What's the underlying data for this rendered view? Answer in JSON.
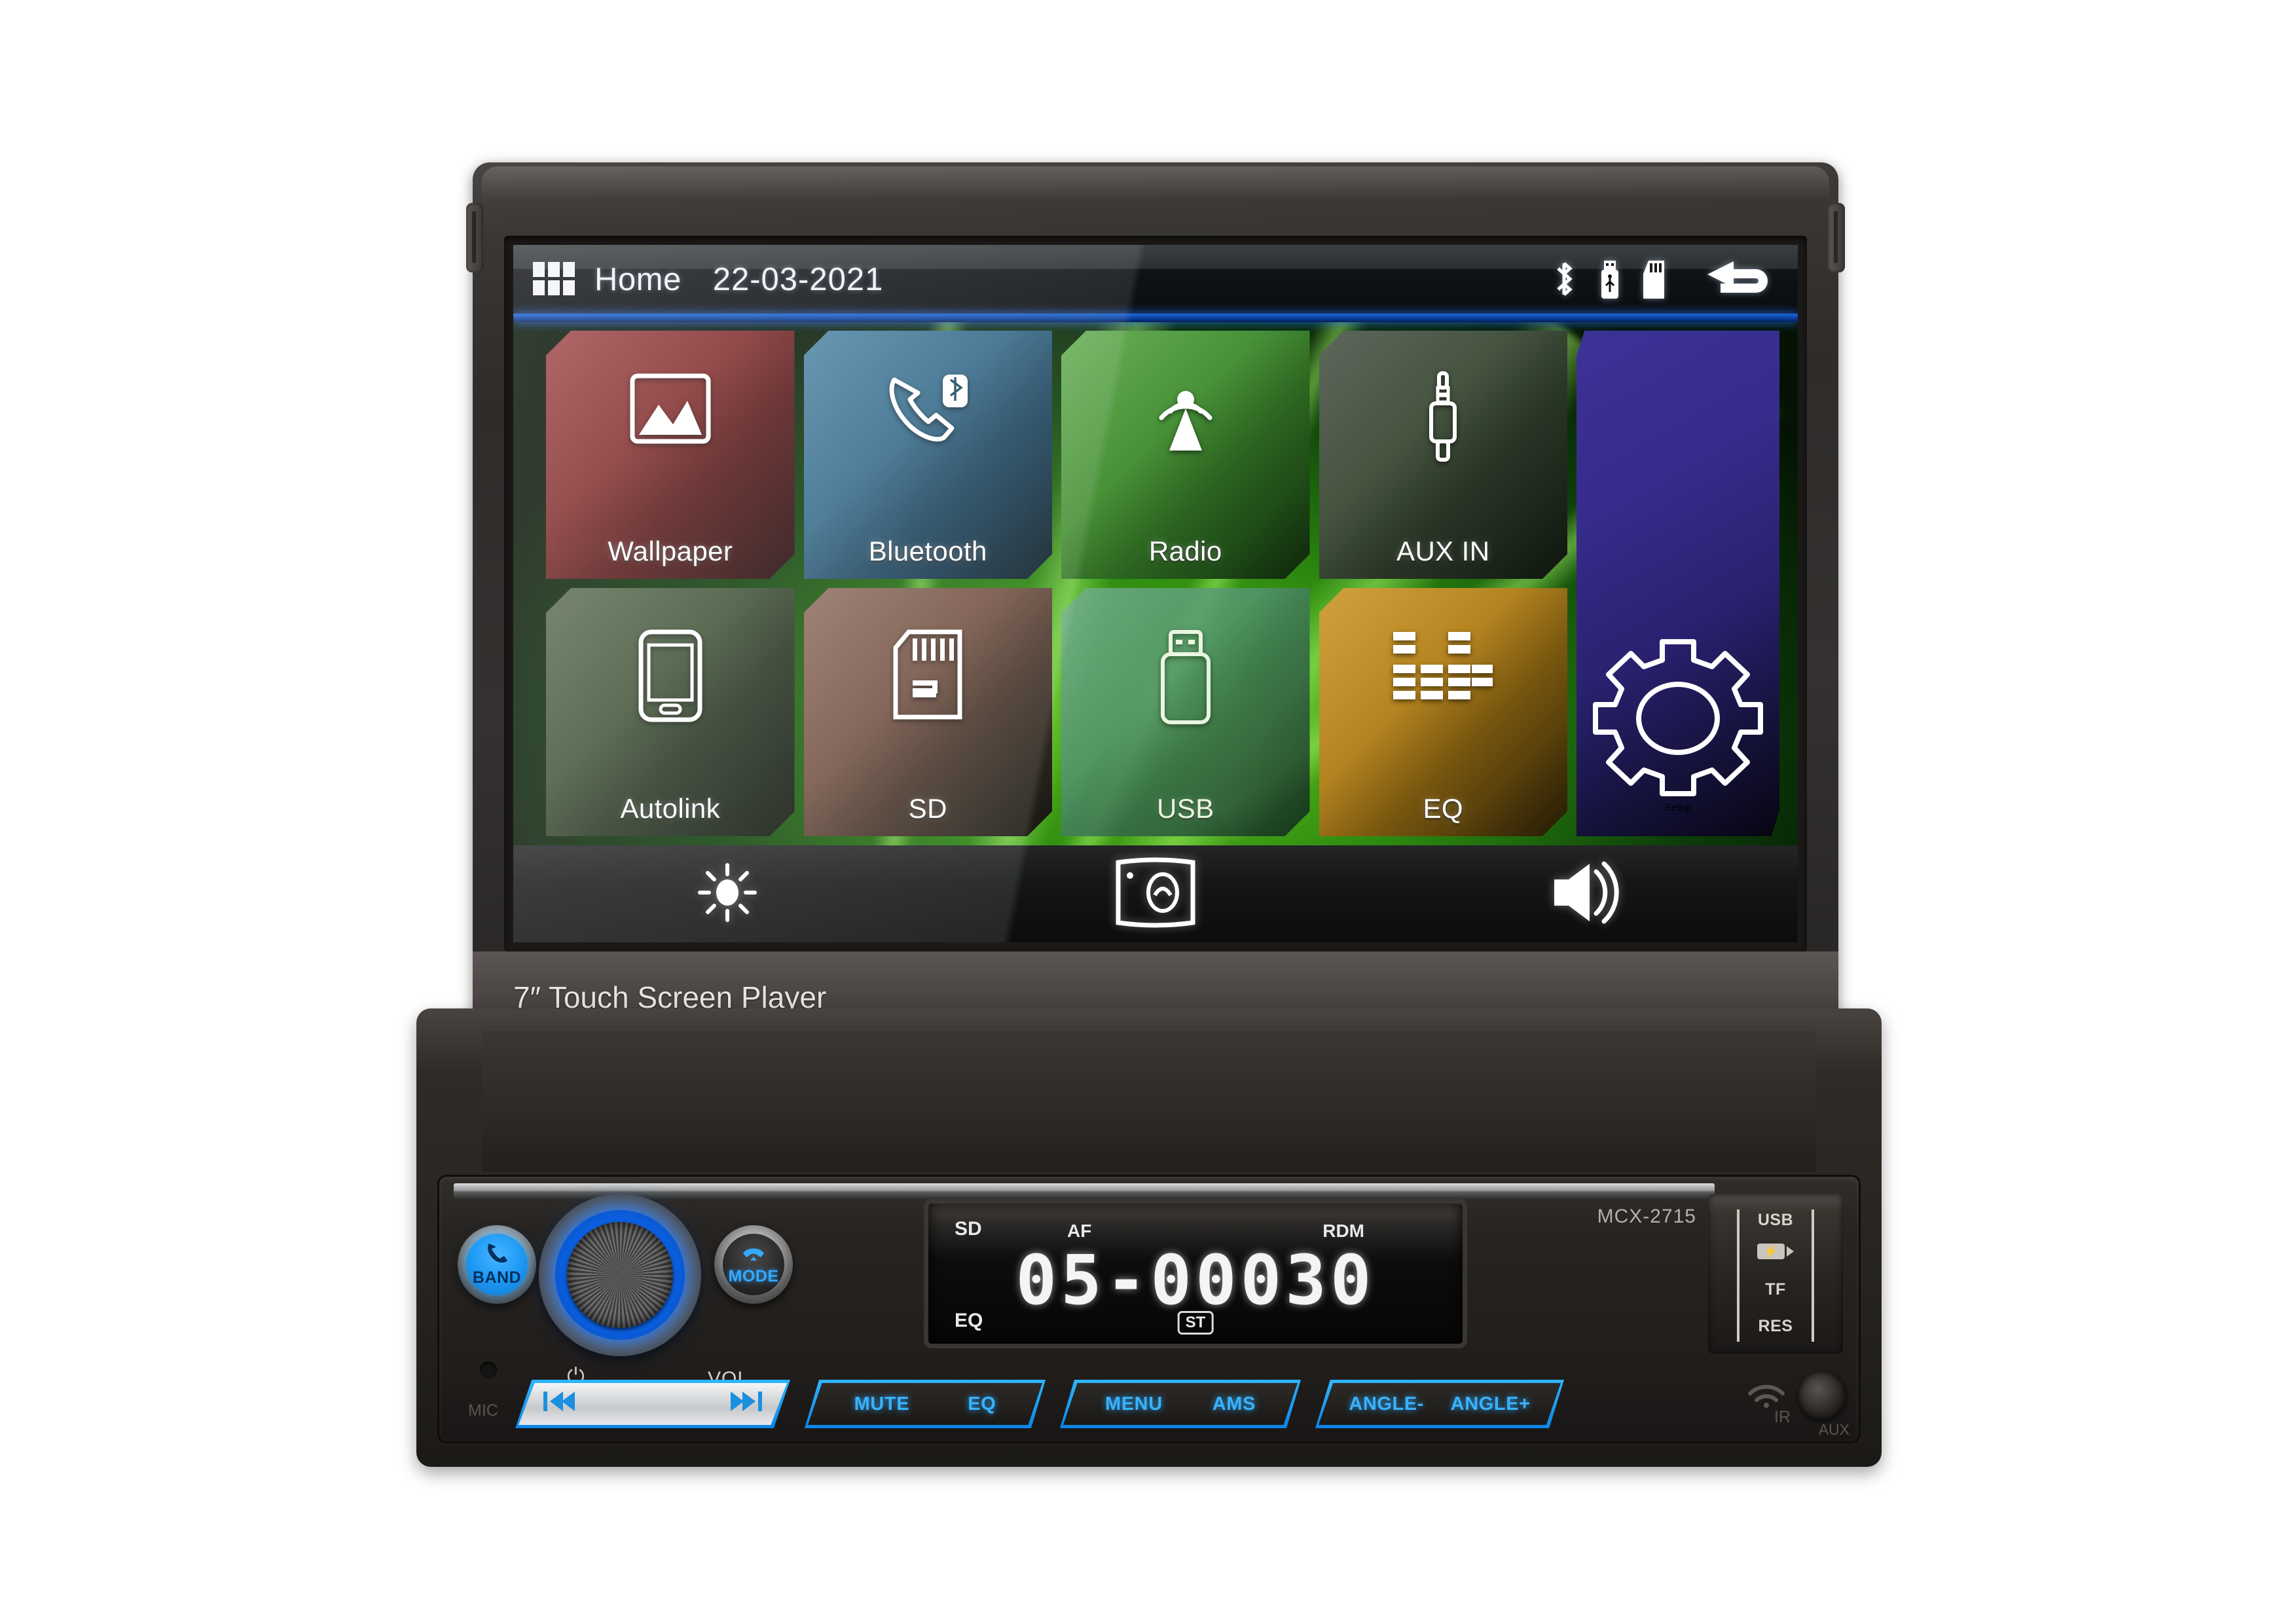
{
  "device": {
    "product_label": "7″ Touch Screen Player",
    "model_number": "MCX-2715"
  },
  "screen": {
    "statusbar": {
      "menu_icon": "grid-apps-icon",
      "title": "Home",
      "date": "22-03-2021",
      "indicators": [
        "bluetooth-icon",
        "usb-drive-icon",
        "sd-card-icon"
      ],
      "back_icon": "back-arrow-icon"
    },
    "apps": [
      {
        "label": "Wallpaper",
        "icon": "picture-icon",
        "color": "#7a1f1f"
      },
      {
        "label": "Bluetooth",
        "icon": "phone-bluetooth-icon",
        "color": "#2a6183"
      },
      {
        "label": "Radio",
        "icon": "radio-tower-icon",
        "color": "#3f8c2e"
      },
      {
        "label": "AUX IN",
        "icon": "aux-jack-icon",
        "color": "#3b4a35"
      },
      {
        "label": "Autolink",
        "icon": "smartphone-icon",
        "color": "#35492c"
      },
      {
        "label": "SD",
        "icon": "sd-card-icon",
        "color": "#6b4839"
      },
      {
        "label": "USB",
        "icon": "usb-stick-icon",
        "color": "#4b8f68"
      },
      {
        "label": "EQ",
        "icon": "equalizer-icon",
        "color": "#b07d14"
      }
    ],
    "feature_tile": {
      "label": "Setup",
      "icon": "gear-icon",
      "color": "#372c8c"
    },
    "bottom_bar": [
      {
        "icon": "brightness-icon"
      },
      {
        "icon": "camera-icon"
      },
      {
        "icon": "volume-icon"
      }
    ]
  },
  "panel": {
    "band_button": {
      "label": "BAND",
      "icon": "phone-answer-icon"
    },
    "mode_button": {
      "label": "MODE",
      "icon": "phone-hangup-icon"
    },
    "volume_knob": {
      "label": "VOL",
      "power_icon": "power-icon"
    },
    "lcd": {
      "sd_label": "SD",
      "eq_label": "EQ",
      "af_label": "AF",
      "rdm_label": "RDM",
      "st_label": "ST",
      "digits": "05-00030"
    },
    "slot_panel": {
      "usb_label": "USB",
      "battery_icon": "charging-battery-icon",
      "tf_label": "TF",
      "res_label": "RES"
    },
    "buttons": [
      {
        "name": "prev-next",
        "left_icon": "previous-track-icon",
        "right_icon": "next-track-icon",
        "style": "filled"
      },
      {
        "name": "mute-eq",
        "left_label": "MUTE",
        "right_label": "EQ",
        "style": "outline"
      },
      {
        "name": "menu-ams",
        "left_label": "MENU",
        "right_label": "AMS",
        "style": "outline"
      },
      {
        "name": "angle",
        "left_label": "ANGLE-",
        "right_label": "ANGLE+",
        "style": "outline"
      }
    ],
    "mic_label": "MIC",
    "ir_label": "IR",
    "aux_label": "AUX"
  }
}
